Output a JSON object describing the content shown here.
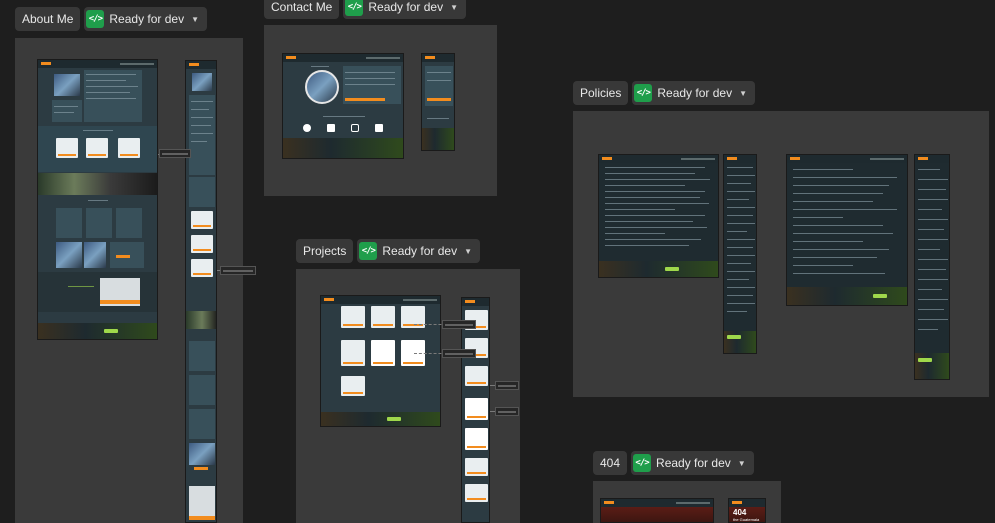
{
  "sections": {
    "about": {
      "name": "About Me",
      "status": "Ready for dev"
    },
    "contact": {
      "name": "Contact Me",
      "status": "Ready for dev"
    },
    "projects": {
      "name": "Projects",
      "status": "Ready for dev"
    },
    "policies": {
      "name": "Policies",
      "status": "Ready for dev"
    },
    "notfound": {
      "name": "404",
      "status": "Ready for dev",
      "heading": "404",
      "subtitle": "the Guatemala"
    }
  },
  "icons": {
    "status": "code-brackets-icon",
    "dropdown": "chevron-down-icon"
  },
  "colors": {
    "canvas": "#1e1e1e",
    "frame": "#3a3a3a",
    "ready": "#1f9e4b",
    "accent": "#f28c1e",
    "screen": "#2c3b42"
  }
}
